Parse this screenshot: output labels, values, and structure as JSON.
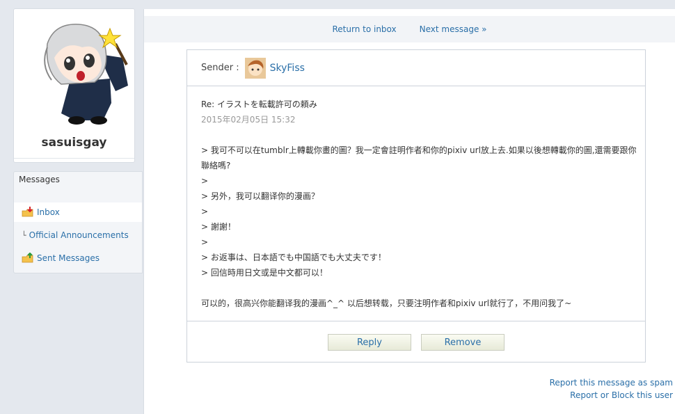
{
  "profile": {
    "username": "sasuisgay"
  },
  "messages_nav": {
    "title": "Messages",
    "items": [
      {
        "label": "Inbox",
        "icon": "folder-inbox-icon",
        "active": true
      },
      {
        "label": "Official Announcements",
        "icon": "sub-item-mark",
        "active": false
      },
      {
        "label": "Sent Messages",
        "icon": "folder-sent-icon",
        "active": false
      }
    ]
  },
  "topbar": {
    "return_label": "Return to inbox",
    "next_label": "Next message »"
  },
  "message": {
    "sender_label": "Sender :",
    "sender_name": "SkyFiss",
    "subject": "Re: イラストを転載許可の頼み",
    "date": "2015年02月05日 15:32",
    "lines": [
      "> 我可不可以在tumblr上轉載你畫的圖？我一定會註明作者和你的pixiv url放上去.如果以後想轉載你的圖,還需要跟你",
      "聯絡嗎?",
      ">",
      "> 另外，我可以翻译你的漫画？",
      ">",
      "> 謝謝！",
      ">",
      "> お返事は、日本語でも中国語でも大丈夫です！",
      "> 回信時用日文或是中文都可以！"
    ],
    "reply_text": "可以的，很高兴你能翻译我的漫画^_^ 以后想转载，只要注明作者和pixiv url就行了，不用问我了~"
  },
  "actions": {
    "reply_label": "Reply",
    "remove_label": "Remove"
  },
  "report": {
    "spam_label": "Report this message as spam",
    "block_label": "Report or Block this user"
  },
  "colors": {
    "link": "#2a6fa8",
    "background": "#e4e8ee",
    "button_top": "#fafbf2",
    "button_bottom": "#e7ead8"
  }
}
